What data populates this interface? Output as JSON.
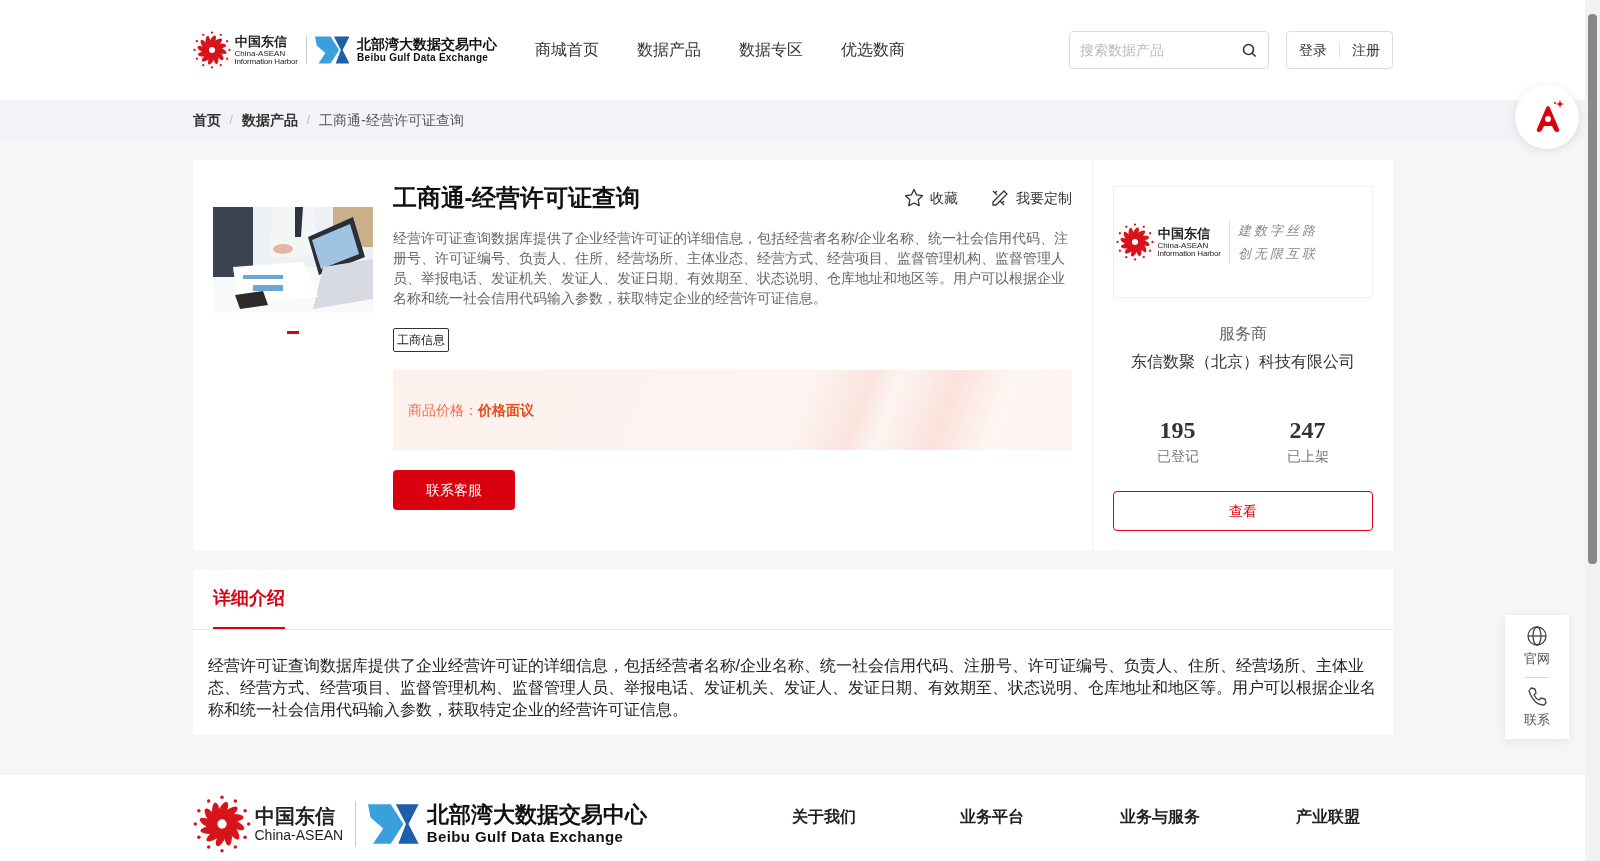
{
  "header": {
    "logo": {
      "name": "中国东信",
      "english": "China-ASEAN",
      "subtitle": "Information Harbor",
      "partner_name": "北部湾大数据交易中心",
      "partner_english": "Beibu Gulf Data Exchange"
    },
    "nav": [
      "商城首页",
      "数据产品",
      "数据专区",
      "优选数商"
    ],
    "search": {
      "placeholder": "搜索数据产品"
    },
    "auth": [
      "登录",
      "注册"
    ]
  },
  "breadcrumb": {
    "separator": "/",
    "items": [
      "首页",
      "数据产品",
      "工商通-经营许可证查询"
    ]
  },
  "product": {
    "title": "工商通-经营许可证查询",
    "actions": [
      {
        "kind": "star",
        "label": "收藏"
      },
      {
        "kind": "custom",
        "label": "我要定制"
      }
    ],
    "description": "经营许可证查询数据库提供了企业经营许可证的详细信息，包括经营者名称/企业名称、统一社会信用代码、注册号、许可证编号、负责人、住所、经营场所、主体业态、经营方式、经营项目、监督管理机构、监督管理人员、举报电话、发证机关、发证人、发证日期、有效期至、状态说明、仓库地址和地区等。用户可以根据企业名称和统一社会信用代码输入参数，获取特定企业的经营许可证信息。",
    "tags": [
      "工商信息"
    ],
    "price_label": "商品价格：",
    "price_value": "价格面议",
    "contact_button": "联系客服",
    "image": {
      "kind": "picture"
    },
    "carousel": [
      {
        "selected": true
      }
    ]
  },
  "provider": {
    "logo": {
      "name": "中国东信",
      "english": "China-ASEAN",
      "subtitle": "Information Harbor",
      "slogan": [
        "建数字丝路",
        "创无限互联"
      ]
    },
    "role": "服务商",
    "name": "东信数聚（北京）科技有限公司",
    "stats": [
      {
        "value": "195",
        "label": "已登记"
      },
      {
        "value": "247",
        "label": "已上架"
      }
    ],
    "button": "查看"
  },
  "detail": {
    "tabs": [
      {
        "label": "详细介绍",
        "selected": true
      }
    ],
    "text": "经营许可证查询数据库提供了企业经营许可证的详细信息，包括经营者名称/企业名称、统一社会信用代码、注册号、许可证编号、负责人、住所、经营场所、主体业态、经营方式、经营项目、监督管理机构、监督管理人员、举报电话、发证机关、发证人、发证日期、有效期至、状态说明、仓库地址和地区等。用户可以根据企业名称和统一社会信用代码输入参数，获取特定企业的经营许可证信息。"
  },
  "footer": {
    "logo": {
      "name": "中国东信",
      "english": "China-ASEAN",
      "partner_name": "北部湾大数据交易中心",
      "partner_english": "Beibu Gulf Data Exchange"
    },
    "links": [
      "关于我们",
      "业务平台",
      "业务与服务",
      "产业联盟"
    ]
  },
  "float_menu": [
    {
      "kind": "globe",
      "label": "官网"
    },
    {
      "kind": "phone",
      "label": "联系"
    }
  ]
}
